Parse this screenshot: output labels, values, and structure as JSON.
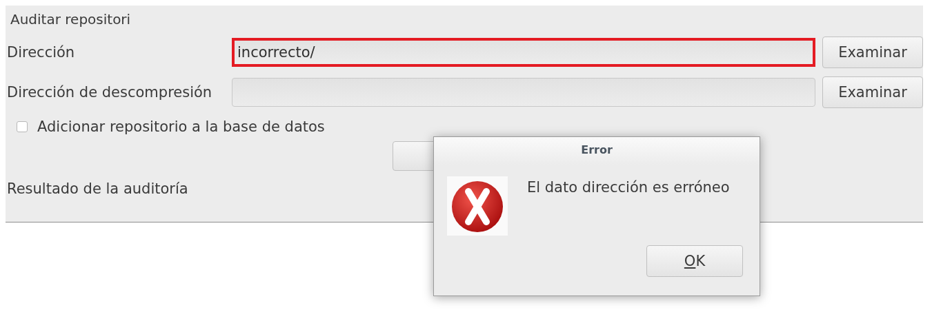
{
  "panel": {
    "title": "Auditar repositori",
    "fields": [
      {
        "label": "Dirección",
        "value": "incorrecto/",
        "invalid": true,
        "button": "Examinar"
      },
      {
        "label": "Dirección de descompresión",
        "invalid": false,
        "button": "Examinar"
      }
    ],
    "checkbox": {
      "label": "Adicionar repositorio a la base de datos",
      "checked": false
    },
    "result": {
      "title": "Resultado de la auditoría"
    }
  },
  "dialog": {
    "title": "Error",
    "message": "El dato dirección es erróneo",
    "button": "OK"
  }
}
